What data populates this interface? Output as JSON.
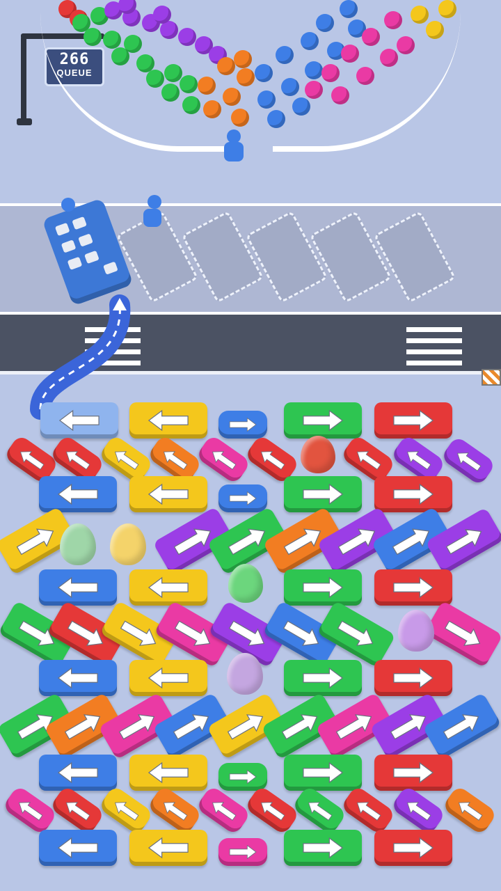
{
  "queue_sign": {
    "count": "266",
    "label": "QUEUE"
  },
  "colors": {
    "red": "#e53838",
    "blue": "#3e7ee6",
    "yellow": "#f4c71c",
    "green": "#2ec551",
    "purple": "#9b3ee6",
    "pink": "#ea3aa4",
    "orange": "#f27d22",
    "lightblue": "#8fb4ee"
  },
  "eggs": [
    {
      "name": "egg-red",
      "color": "#e2543f"
    },
    {
      "name": "egg-rainbow",
      "color": "#9fd6a8"
    },
    {
      "name": "egg-yellow",
      "color": "#f4d36a"
    },
    {
      "name": "egg-green",
      "color": "#6cd67d"
    },
    {
      "name": "egg-purple",
      "color": "#c89ae8"
    },
    {
      "name": "egg-lilac",
      "color": "#c4a6e0"
    }
  ],
  "parking_slots": {
    "total": 5,
    "filled": 0
  },
  "icons": [
    "left-arrow-icon",
    "right-arrow-icon",
    "up-arrow-icon",
    "person-icon"
  ]
}
